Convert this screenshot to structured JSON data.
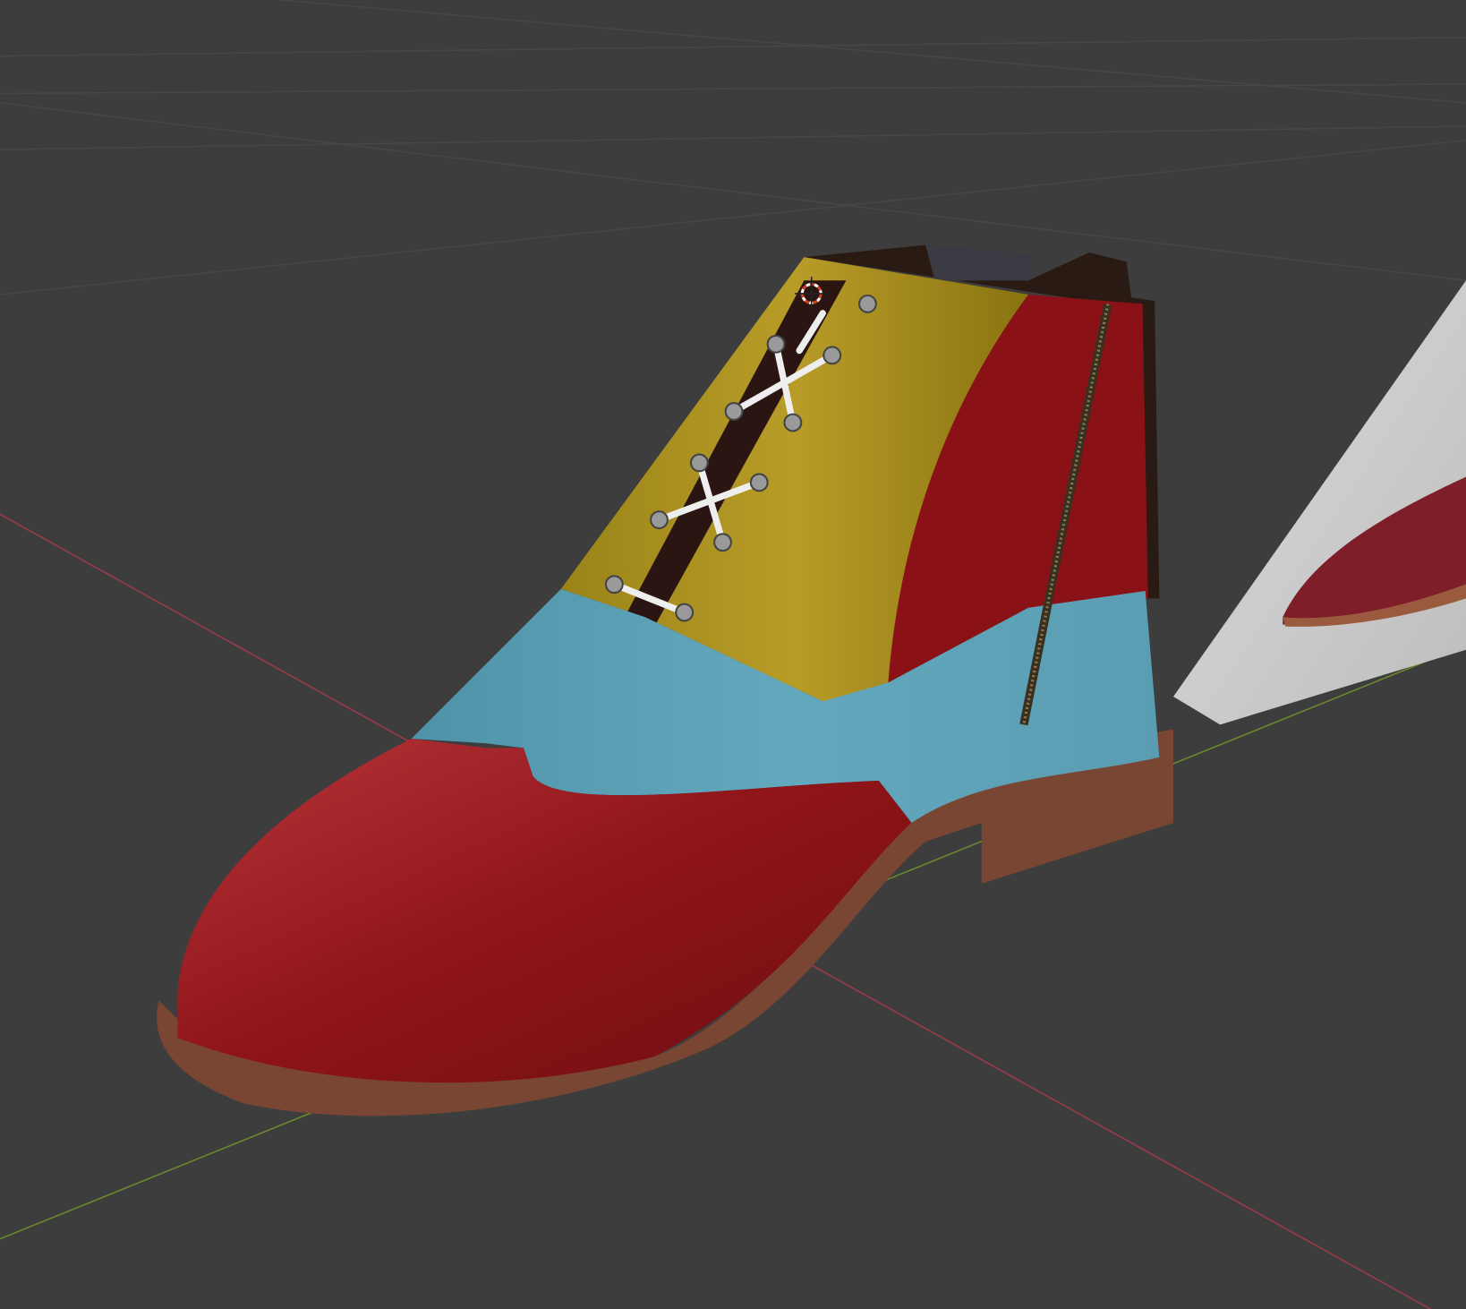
{
  "viewport": {
    "background_color": "#3d3d3d",
    "grid_color": "#474747",
    "x_axis_color": "#9a3c48",
    "y_axis_color": "#6a8a2e"
  },
  "scene": {
    "object": "shoe",
    "colors": {
      "toe_cap": "#8e1418",
      "vamp": "#5aa0b5",
      "quarter_left": "#a8901c",
      "quarter_right": "#8a1216",
      "lining": "#2a1a14",
      "sole": "#7a4634",
      "laces": "#eeeeee",
      "zipper": "#3a3020"
    },
    "reference_image_plane": "shoe-photo"
  },
  "icons": {
    "cursor_3d": "3d-cursor-icon"
  }
}
